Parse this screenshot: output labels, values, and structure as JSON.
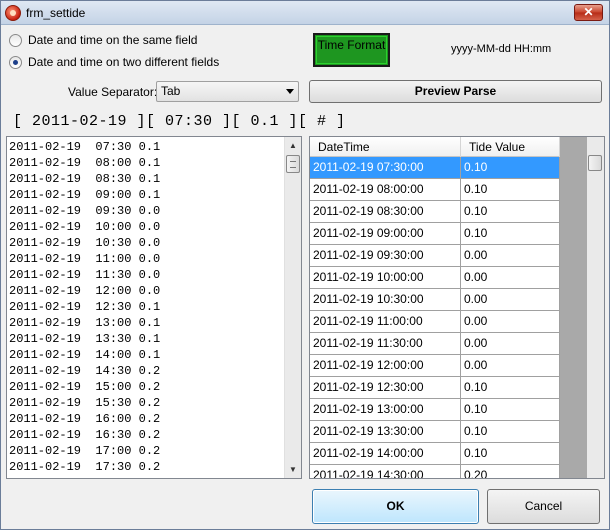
{
  "window": {
    "title": "frm_settide",
    "close_glyph": "✕"
  },
  "options": {
    "same_field_label": "Date and time on the same field",
    "two_fields_label": "Date and time on two different fields",
    "selected": "two_fields"
  },
  "time_format": {
    "button_label": "Time Format",
    "format_string": "yyyy-MM-dd HH:mm"
  },
  "separator": {
    "label": "Value Separator:",
    "value": "Tab"
  },
  "preview": {
    "button_label": "Preview Parse"
  },
  "pattern_text": "[ 2011-02-19 ][ 07:30 ][ 0.1 ][ # ]",
  "raw_lines": [
    "2011-02-19  07:30 0.1",
    "2011-02-19  08:00 0.1",
    "2011-02-19  08:30 0.1",
    "2011-02-19  09:00 0.1",
    "2011-02-19  09:30 0.0",
    "2011-02-19  10:00 0.0",
    "2011-02-19  10:30 0.0",
    "2011-02-19  11:00 0.0",
    "2011-02-19  11:30 0.0",
    "2011-02-19  12:00 0.0",
    "2011-02-19  12:30 0.1",
    "2011-02-19  13:00 0.1",
    "2011-02-19  13:30 0.1",
    "2011-02-19  14:00 0.1",
    "2011-02-19  14:30 0.2",
    "2011-02-19  15:00 0.2",
    "2011-02-19  15:30 0.2",
    "2011-02-19  16:00 0.2",
    "2011-02-19  16:30 0.2",
    "2011-02-19  17:00 0.2",
    "2011-02-19  17:30 0.2"
  ],
  "grid": {
    "columns": [
      "DateTime",
      "Tide Value"
    ],
    "rows": [
      [
        "2011-02-19 07:30:00",
        "0.10"
      ],
      [
        "2011-02-19 08:00:00",
        "0.10"
      ],
      [
        "2011-02-19 08:30:00",
        "0.10"
      ],
      [
        "2011-02-19 09:00:00",
        "0.10"
      ],
      [
        "2011-02-19 09:30:00",
        "0.00"
      ],
      [
        "2011-02-19 10:00:00",
        "0.00"
      ],
      [
        "2011-02-19 10:30:00",
        "0.00"
      ],
      [
        "2011-02-19 11:00:00",
        "0.00"
      ],
      [
        "2011-02-19 11:30:00",
        "0.00"
      ],
      [
        "2011-02-19 12:00:00",
        "0.00"
      ],
      [
        "2011-02-19 12:30:00",
        "0.10"
      ],
      [
        "2011-02-19 13:00:00",
        "0.10"
      ],
      [
        "2011-02-19 13:30:00",
        "0.10"
      ],
      [
        "2011-02-19 14:00:00",
        "0.10"
      ],
      [
        "2011-02-19 14:30:00",
        "0.20"
      ]
    ],
    "selected_row": 0
  },
  "buttons": {
    "ok_label": "OK",
    "cancel_label": "Cancel"
  },
  "colors": {
    "time_format_bg": "#1e9620",
    "selection": "#3399ff"
  }
}
